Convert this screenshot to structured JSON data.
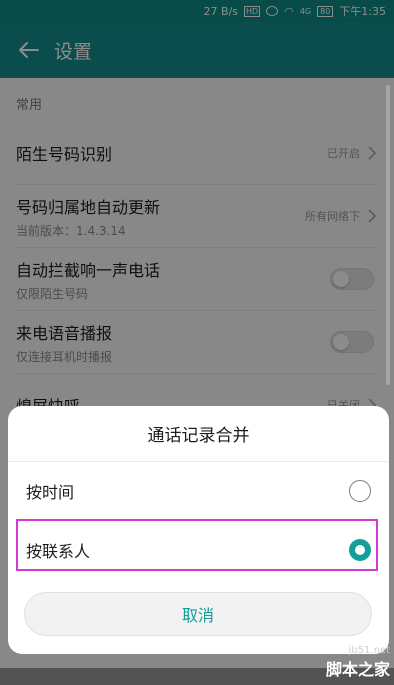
{
  "status_bar": {
    "speed": "27 B/s",
    "hd": "HD",
    "network": "4G",
    "battery": "80",
    "time": "下午1:35"
  },
  "app_bar": {
    "title": "设置"
  },
  "section": {
    "label": "常用"
  },
  "rows": [
    {
      "title": "陌生号码识别",
      "subtitle": "",
      "value": "已开启",
      "control": "chevron"
    },
    {
      "title": "号码归属地自动更新",
      "subtitle": "当前版本：1.4.3.14",
      "value": "所有网络下",
      "control": "chevron"
    },
    {
      "title": "自动拦截响一声电话",
      "subtitle": "仅限陌生号码",
      "value": "",
      "control": "switch"
    },
    {
      "title": "来电语音播报",
      "subtitle": "仅连接耳机时播报",
      "value": "",
      "control": "switch"
    },
    {
      "title": "熄屏快呼",
      "subtitle": "",
      "value": "已关闭",
      "control": "chevron"
    }
  ],
  "dialog": {
    "title": "通话记录合并",
    "options": [
      {
        "label": "按时间",
        "selected": false
      },
      {
        "label": "按联系人",
        "selected": true
      }
    ],
    "cancel_label": "取消"
  },
  "watermark": {
    "url": "jb51.net",
    "name": "脚本之家"
  },
  "colors": {
    "accent": "#138d8a",
    "radio_checked": "#139e99",
    "highlight": "#d33ad6"
  }
}
